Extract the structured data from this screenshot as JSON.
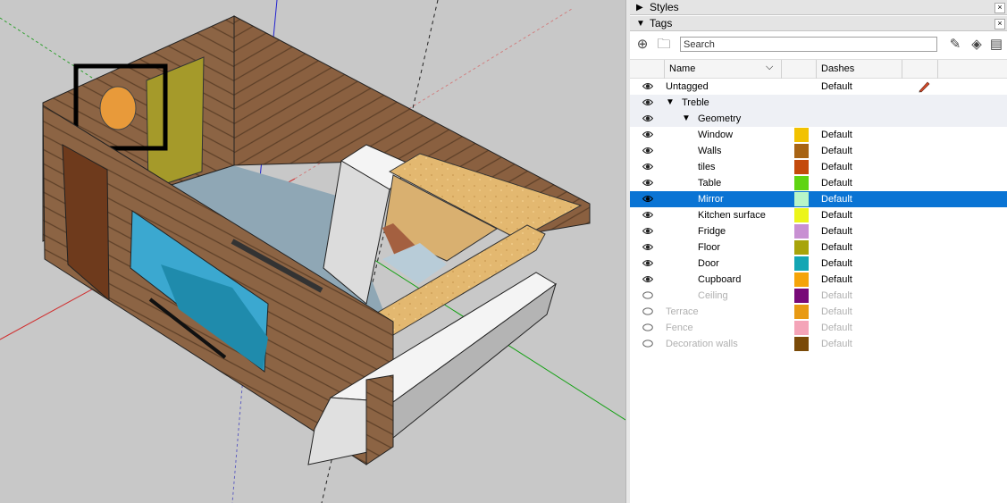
{
  "trays": {
    "styles": {
      "title": "Styles",
      "arrow": "▶",
      "close": "×"
    },
    "tags": {
      "title": "Tags",
      "arrow": "▼",
      "close": "×"
    }
  },
  "toolbar": {
    "search_placeholder": "Search",
    "add_tag_icon": "⊕",
    "add_folder_icon": "🗀",
    "paint_icon": "✎",
    "color_by_tag_icon": "◈",
    "details_icon": "▤"
  },
  "columns": {
    "name": "Name",
    "sort": "⌵",
    "dashes": "Dashes"
  },
  "tags": [
    {
      "name": "Untagged",
      "indent": 0,
      "visible": true,
      "dashes": "Default",
      "swatch": "",
      "twisty": "",
      "group": false,
      "selected": false,
      "dim": false,
      "pencil": true
    },
    {
      "name": "Treble",
      "indent": 1,
      "visible": true,
      "dashes": "",
      "swatch": "",
      "twisty": "▼",
      "group": true,
      "selected": false,
      "dim": false
    },
    {
      "name": "Geometry",
      "indent": 2,
      "visible": true,
      "dashes": "",
      "swatch": "",
      "twisty": "▼",
      "group": true,
      "selected": false,
      "dim": false
    },
    {
      "name": "Window",
      "indent": 3,
      "visible": true,
      "dashes": "Default",
      "swatch": "#f2c200",
      "selected": false,
      "dim": false
    },
    {
      "name": "Walls",
      "indent": 3,
      "visible": true,
      "dashes": "Default",
      "swatch": "#a86414",
      "selected": false,
      "dim": false
    },
    {
      "name": "tiles",
      "indent": 3,
      "visible": true,
      "dashes": "Default",
      "swatch": "#c44a0c",
      "selected": false,
      "dim": false
    },
    {
      "name": "Table",
      "indent": 3,
      "visible": true,
      "dashes": "Default",
      "swatch": "#5fd412",
      "selected": false,
      "dim": false
    },
    {
      "name": "Mirror",
      "indent": 3,
      "visible": true,
      "dashes": "Default",
      "swatch": "#b8f5c8",
      "selected": true,
      "dim": false
    },
    {
      "name": "Kitchen surface",
      "indent": 3,
      "visible": true,
      "dashes": "Default",
      "swatch": "#ecf51a",
      "selected": false,
      "dim": false
    },
    {
      "name": "Fridge",
      "indent": 3,
      "visible": true,
      "dashes": "Default",
      "swatch": "#c890d2",
      "selected": false,
      "dim": false
    },
    {
      "name": "Floor",
      "indent": 3,
      "visible": true,
      "dashes": "Default",
      "swatch": "#a8a40a",
      "selected": false,
      "dim": false
    },
    {
      "name": "Door",
      "indent": 3,
      "visible": true,
      "dashes": "Default",
      "swatch": "#14a6b4",
      "selected": false,
      "dim": false
    },
    {
      "name": "Cupboard",
      "indent": 3,
      "visible": true,
      "dashes": "Default",
      "swatch": "#f5a40a",
      "selected": false,
      "dim": false
    },
    {
      "name": "Ceiling",
      "indent": 3,
      "visible": false,
      "dashes": "Default",
      "swatch": "#780a78",
      "selected": false,
      "dim": true
    },
    {
      "name": "Terrace",
      "indent": 0,
      "visible": false,
      "dashes": "Default",
      "swatch": "#e89a14",
      "selected": false,
      "dim": true
    },
    {
      "name": "Fence",
      "indent": 0,
      "visible": false,
      "dashes": "Default",
      "swatch": "#f4a4b8",
      "selected": false,
      "dim": true
    },
    {
      "name": "Decoration walls",
      "indent": 0,
      "visible": false,
      "dashes": "Default",
      "swatch": "#7a4a08",
      "selected": false,
      "dim": true
    }
  ],
  "colors": {
    "selection": "#0a74d4",
    "viewport_bg": "#c8c8c8"
  }
}
